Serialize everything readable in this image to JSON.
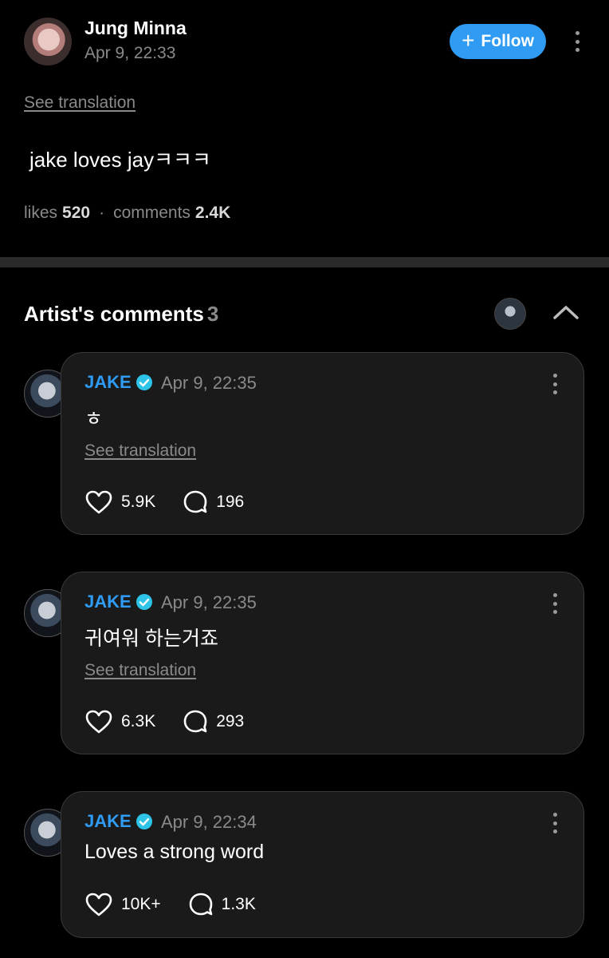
{
  "post": {
    "author": "Jung Minna",
    "date": "Apr 9, 22:33",
    "follow_label": "Follow",
    "see_translation": "See translation",
    "body": "jake loves jayㅋㅋㅋ",
    "likes_label": "likes",
    "likes_count": "520",
    "comments_label": "comments",
    "comments_count": "2.4K"
  },
  "artist_comments": {
    "title": "Artist's comments",
    "count": "3",
    "items": [
      {
        "name": "JAKE",
        "date": "Apr 9, 22:35",
        "text": "ㅎ",
        "see_translation": "See translation",
        "likes": "5.9K",
        "replies": "196"
      },
      {
        "name": "JAKE",
        "date": "Apr 9, 22:35",
        "text": "귀여워 하는거죠",
        "see_translation": "See translation",
        "likes": "6.3K",
        "replies": "293"
      },
      {
        "name": "JAKE",
        "date": "Apr 9, 22:34",
        "text": "Loves a strong word",
        "likes": "10K+",
        "replies": "1.3K"
      }
    ]
  },
  "icons": {
    "follow": "plus-icon",
    "menu": "more-vertical-icon",
    "collapse": "chevron-up-icon",
    "verified": "verified-badge-icon",
    "like": "heart-icon",
    "reply": "speech-bubble-icon"
  },
  "colors": {
    "background": "#000000",
    "accent": "#2f9bf3",
    "verified": "#2ec4e8",
    "card": "#1a1a1a",
    "muted": "#8a8a8a"
  }
}
